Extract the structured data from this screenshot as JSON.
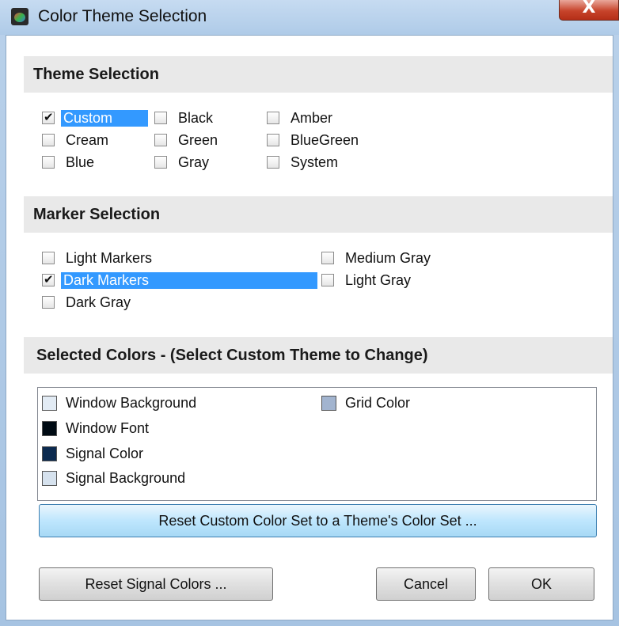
{
  "window": {
    "title": "Color Theme Selection",
    "close_glyph": "X"
  },
  "theme": {
    "heading": "Theme Selection",
    "options": [
      {
        "label": "Custom",
        "checked": true,
        "selected": true
      },
      {
        "label": "Cream",
        "checked": false
      },
      {
        "label": "Blue",
        "checked": false
      },
      {
        "label": "Black",
        "checked": false
      },
      {
        "label": "Green",
        "checked": false
      },
      {
        "label": "Gray",
        "checked": false
      },
      {
        "label": "Amber",
        "checked": false
      },
      {
        "label": "BlueGreen",
        "checked": false
      },
      {
        "label": "System",
        "checked": false
      }
    ]
  },
  "marker": {
    "heading": "Marker Selection",
    "options": [
      {
        "label": "Light Markers",
        "checked": false
      },
      {
        "label": "Dark Markers",
        "checked": true,
        "selected": true
      },
      {
        "label": "Dark Gray",
        "checked": false
      },
      {
        "label": "Medium Gray",
        "checked": false
      },
      {
        "label": "Light Gray",
        "checked": false
      }
    ]
  },
  "colors": {
    "heading": "Selected Colors - (Select Custom Theme to Change)",
    "items": [
      {
        "label": "Window Background",
        "color": "#e2ebf4"
      },
      {
        "label": "Window Font",
        "color": "#000b14"
      },
      {
        "label": "Signal Color",
        "color": "#0b2a4f"
      },
      {
        "label": "Signal Background",
        "color": "#d6e2ee"
      },
      {
        "label": "Grid Color",
        "color": "#a2b4cf"
      }
    ]
  },
  "buttons": {
    "reset_custom": "Reset Custom Color Set to a Theme's Color Set ...",
    "reset_signal": "Reset Signal Colors ...",
    "cancel": "Cancel",
    "ok": "OK"
  },
  "theme_colors": {
    "selection_highlight": "#3399ff",
    "section_header_bg": "#e9e9e9"
  }
}
